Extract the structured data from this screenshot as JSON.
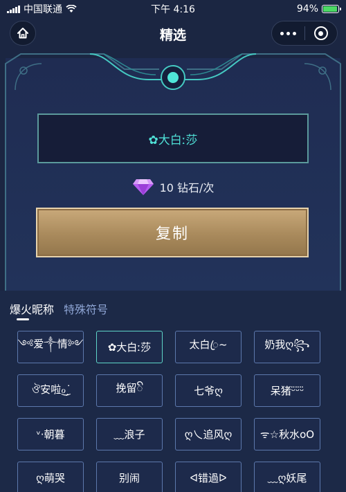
{
  "status_bar": {
    "carrier": "中国联通",
    "time": "下午 4:16",
    "battery": "94%",
    "battery_level": 0.94
  },
  "nav": {
    "title": "精选"
  },
  "name_display": "✿大白ː莎",
  "cost_text": "10 钻石/次",
  "copy_label": "复制",
  "tabs": [
    "爆火昵称",
    "特殊符号"
  ],
  "nicknames": [
    "༺爱༒情༻",
    "✿大白ː莎",
    "太白ꦿ~",
    "奶我ღ꧂",
    "ঔ安啦ℴ͜ ̗͘͘",
    "挽留ꦼ",
    "七爷ღ",
    "呆猪ᵕ̈ᵕ̈ᵕ̈",
    "ᵛ·朝暮",
    "﹏浪子",
    "ღ乀追风ღ",
    "ᯤ☆秋水oO",
    "ღ萌哭",
    "别闹",
    "ᐊ错過ᐅ",
    "﹏ღ妖尾"
  ],
  "colors": {
    "background": "#1b2642",
    "accent_teal": "#4fe0d6",
    "gold": "#b89768",
    "cell_border": "#5d79ad"
  }
}
